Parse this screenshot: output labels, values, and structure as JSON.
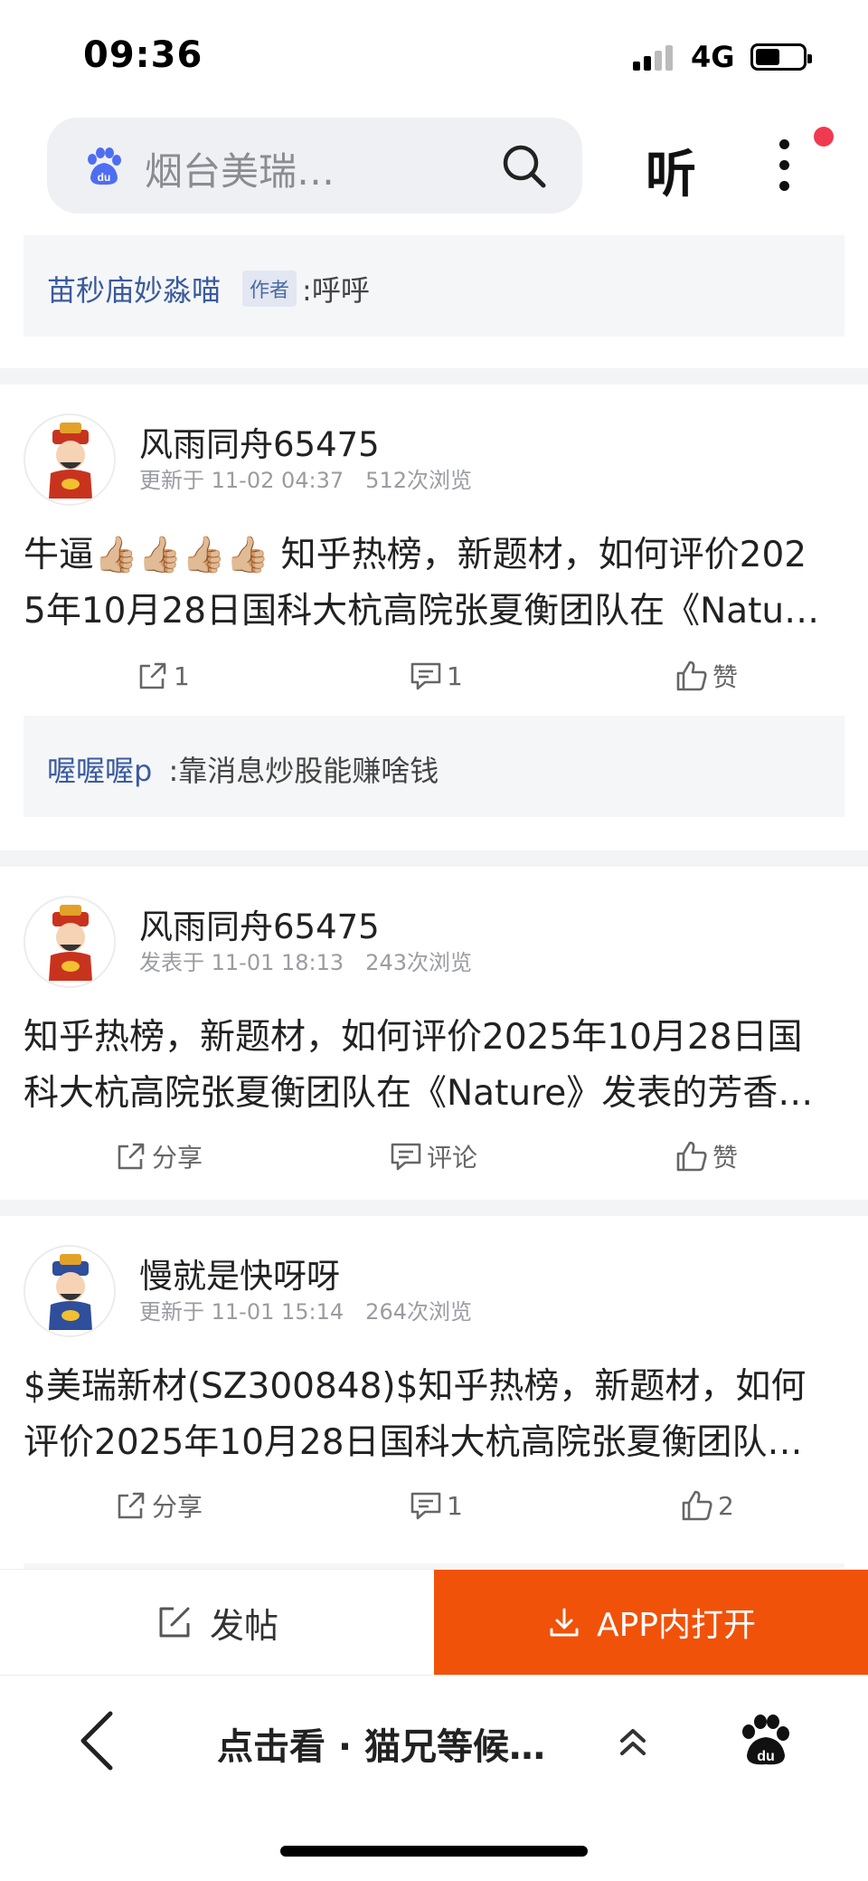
{
  "status_bar": {
    "time": "09:36",
    "network": "4G"
  },
  "header": {
    "search_placeholder": "烟台美瑞…",
    "listen_label": "听"
  },
  "top_reply": {
    "name": "苗秒庙妙淼喵",
    "author_tag": "作者",
    "text": ":呼呼"
  },
  "posts": [
    {
      "username": "风雨同舟65475",
      "time": "更新于 11-02 04:37",
      "views": "512次浏览",
      "content_line1": "牛逼👍🏼👍🏼👍🏼👍🏼 知乎热榜，新题材，如何评价202",
      "content_line2": "5年10月28日国科大杭高院张夏衡团队在《Natu…",
      "share": "1",
      "comment": "1",
      "like": "赞",
      "reply": {
        "name": "喔喔喔p",
        "text": ":靠消息炒股能赚啥钱"
      }
    },
    {
      "username": "风雨同舟65475",
      "time": "发表于 11-01 18:13",
      "views": "243次浏览",
      "content_line1": "知乎热榜，新题材，如何评价2025年10月28日国",
      "content_line2": "科大杭高院张夏衡团队在《Nature》发表的芳香…",
      "share": "分享",
      "comment": "评论",
      "like": "赞"
    },
    {
      "username": "慢就是快呀呀",
      "time": "更新于 11-01 15:14",
      "views": "264次浏览",
      "content_line1": "$美瑞新材(SZ300848)$知乎热榜，新题材，如何",
      "content_line2": "评价2025年10月28日国科大杭高院张夏衡团队…",
      "share": "分享",
      "comment": "1",
      "like": "2"
    }
  ],
  "bottom_bar": {
    "post_label": "发帖",
    "open_app_label": "APP内打开"
  },
  "nav": {
    "title": "点击看 · 猫兄等候…"
  },
  "colors": {
    "accent": "#f0520a",
    "link": "#3a5b9c",
    "notify": "#f03a4f"
  }
}
